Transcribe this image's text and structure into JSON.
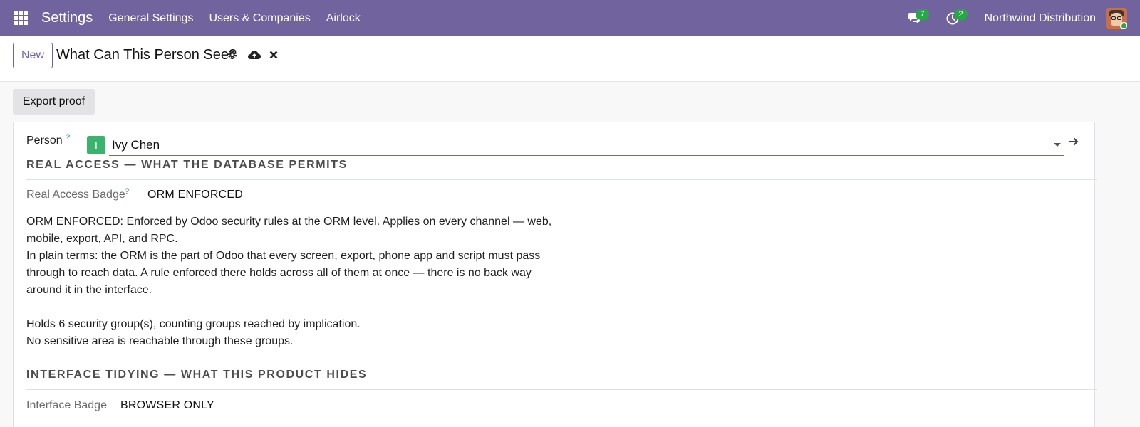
{
  "navbar": {
    "app_title": "Settings",
    "menu": [
      {
        "label": "General Settings"
      },
      {
        "label": "Users & Companies"
      },
      {
        "label": "Airlock"
      }
    ],
    "messages_count": "7",
    "activities_count": "2",
    "company": "Northwind Distribution",
    "brand_color": "#71639e"
  },
  "control_panel": {
    "new_label": "New",
    "record_title": "What Can This Person See?"
  },
  "actions": {
    "export_label": "Export proof"
  },
  "form": {
    "person": {
      "label": "Person",
      "help": "?",
      "initial": "I",
      "value": "Ivy Chen"
    },
    "real_access": {
      "section_title": "REAL ACCESS — WHAT THE DATABASE PERMITS",
      "badge_label": "Real Access Badge",
      "badge_help": "?",
      "badge_value": "ORM ENFORCED",
      "lines": [
        "ORM ENFORCED: Enforced by Odoo security rules at the ORM level. Applies on every channel — web, mobile, export, API, and RPC.",
        "In plain terms: the ORM is the part of Odoo that every screen, export, phone app and script must pass through to reach data. A rule enforced there holds across all of them at once — there is no back way around it in the interface.",
        "Holds 6 security group(s), counting groups reached by implication.",
        "No sensitive area is reachable through these groups."
      ]
    },
    "interface": {
      "section_title": "INTERFACE TIDYING — WHAT THIS PRODUCT HIDES",
      "badge_label": "Interface Badge",
      "badge_value": "BROWSER ONLY"
    }
  }
}
